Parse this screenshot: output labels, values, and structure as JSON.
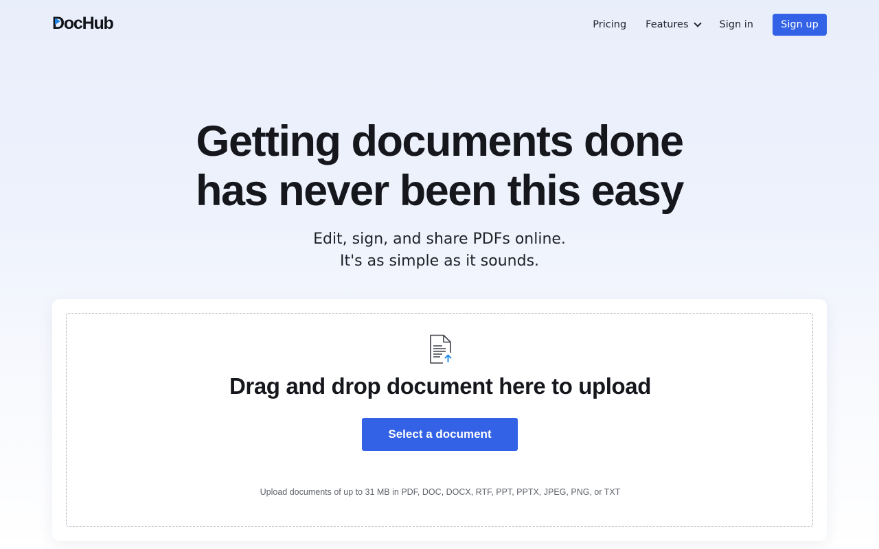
{
  "header": {
    "logo_text": "DocHub",
    "logo_first_letter": "D",
    "logo_rest": "ocHub",
    "nav": {
      "pricing": "Pricing",
      "features": "Features",
      "sign_in": "Sign in",
      "sign_up": "Sign up"
    }
  },
  "hero": {
    "title_line1": "Getting documents done",
    "title_line2": "has never been this easy",
    "subtitle_line1": "Edit, sign, and share PDFs online.",
    "subtitle_line2": "It's as simple as it sounds."
  },
  "upload": {
    "icon": "document-upload-icon",
    "title": "Drag and drop document here to upload",
    "button_label": "Select a document",
    "note": "Upload documents of up to 31 MB in PDF, DOC, DOCX, RTF, PPT, PPTX, JPEG, PNG, or TXT"
  },
  "colors": {
    "primary": "#3362e6",
    "logo_accent": "#1a7fe0",
    "upload_arrow": "#2b8fe8",
    "text_dark": "#15171c",
    "note_gray": "#5f636b",
    "background_top": "#e9eefb"
  }
}
